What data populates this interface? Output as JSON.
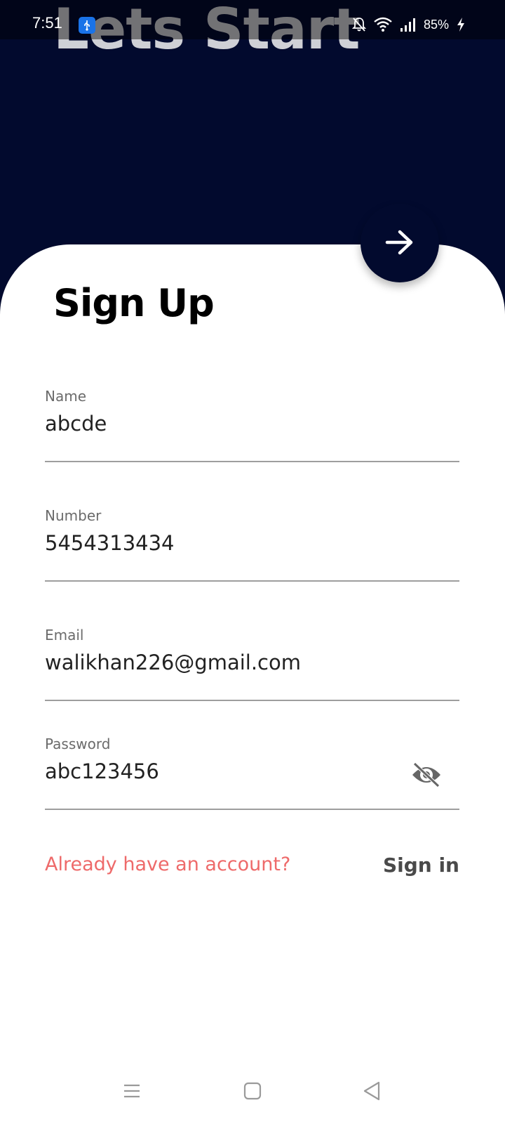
{
  "status_bar": {
    "time": "7:51",
    "battery": "85%",
    "icons": [
      "usb-icon",
      "bell-muted-icon",
      "wifi-icon",
      "signal-icon",
      "charging-bolt-icon"
    ]
  },
  "hero": {
    "title": "Lets Start"
  },
  "form": {
    "title": "Sign Up",
    "fields": [
      {
        "label": "Name",
        "value": "abcde"
      },
      {
        "label": "Number",
        "value": "5454313434"
      },
      {
        "label": "Email",
        "value": "walikhan226@gmail.com"
      },
      {
        "label": "Password",
        "value": "abc123456",
        "icon": "eye-off-icon"
      }
    ],
    "submit_icon": "arrow-right-icon"
  },
  "footer": {
    "prompt": "Already have an account?",
    "action": "Sign in"
  },
  "nav": {
    "icons": [
      "menu-icon",
      "home-square-icon",
      "back-triangle-icon"
    ]
  },
  "colors": {
    "hero_bg": "#020a2e",
    "accent_link": "#ee6a6a",
    "card_bg": "#ffffff"
  }
}
